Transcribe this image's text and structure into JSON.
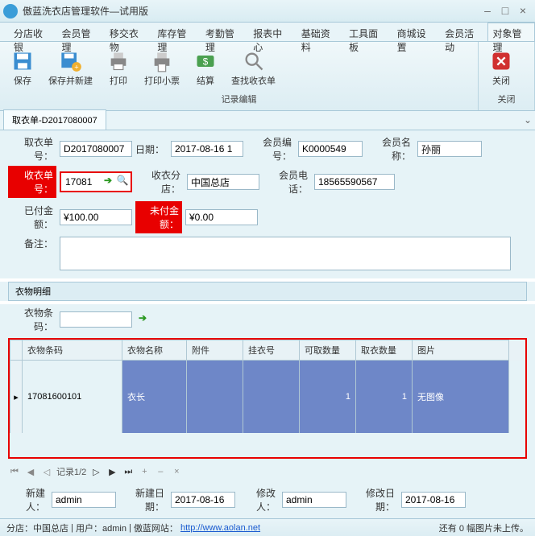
{
  "window": {
    "title": "傲蓝洗衣店管理软件—试用版"
  },
  "mainTabs": [
    "分店收银",
    "会员管理",
    "移交衣物",
    "库存管理",
    "考勤管理",
    "报表中心",
    "基础资料",
    "工具面板",
    "商城设置",
    "会员活动",
    "对象管理"
  ],
  "mainTabActive": 10,
  "toolbar": {
    "save": "保存",
    "saveNew": "保存并新建",
    "print": "打印",
    "printTicket": "打印小票",
    "settle": "结算",
    "findReceipt": "查找收衣单",
    "close": "关闭",
    "group1": "记录编辑",
    "group2": "关闭"
  },
  "subTab": "取衣单-D2017080007",
  "form": {
    "labels": {
      "pickNo": "取衣单号：",
      "date": "日期：",
      "memberNo": "会员编号：",
      "memberName": "会员名称：",
      "receiptNo": "收衣单号：",
      "branch": "收衣分店：",
      "phone": "会员电话：",
      "paid": "已付金额：",
      "unpaid": "未付金额：",
      "remark": "备注："
    },
    "pickNo": "D2017080007",
    "date": "2017-08-16 1",
    "memberNo": "K0000549",
    "memberName": "孙丽",
    "receiptNo": "17081",
    "branch": "中国总店",
    "phone": "18565590567",
    "paid": "¥100.00",
    "unpaid": "¥0.00",
    "remark": ""
  },
  "detailHeader": "衣物明细",
  "barcodeLabel": "衣物条码：",
  "barcodeValue": "",
  "grid": {
    "headers": [
      "",
      "衣物条码",
      "衣物名称",
      "附件",
      "挂衣号",
      "可取数量",
      "取衣数量",
      "图片"
    ],
    "row": {
      "barcode": "17081600101",
      "name": "衣长",
      "attach": "",
      "hang": "",
      "avail": "1",
      "take": "1",
      "image": "无图像"
    }
  },
  "pager": {
    "text": "记录1/2"
  },
  "audit": {
    "createByLbl": "新建人：",
    "createBy": "admin",
    "createDateLbl": "新建日期：",
    "createDate": "2017-08-16",
    "modByLbl": "修改人：",
    "modBy": "admin",
    "modDateLbl": "修改日期：",
    "modDate": "2017-08-16"
  },
  "status": {
    "branch": "分店：中国总店",
    "user": "用户：admin",
    "siteLbl": "傲蓝网站：",
    "siteUrl": "http://www.aolan.net",
    "right": "还有 0 幅图片未上传。"
  }
}
